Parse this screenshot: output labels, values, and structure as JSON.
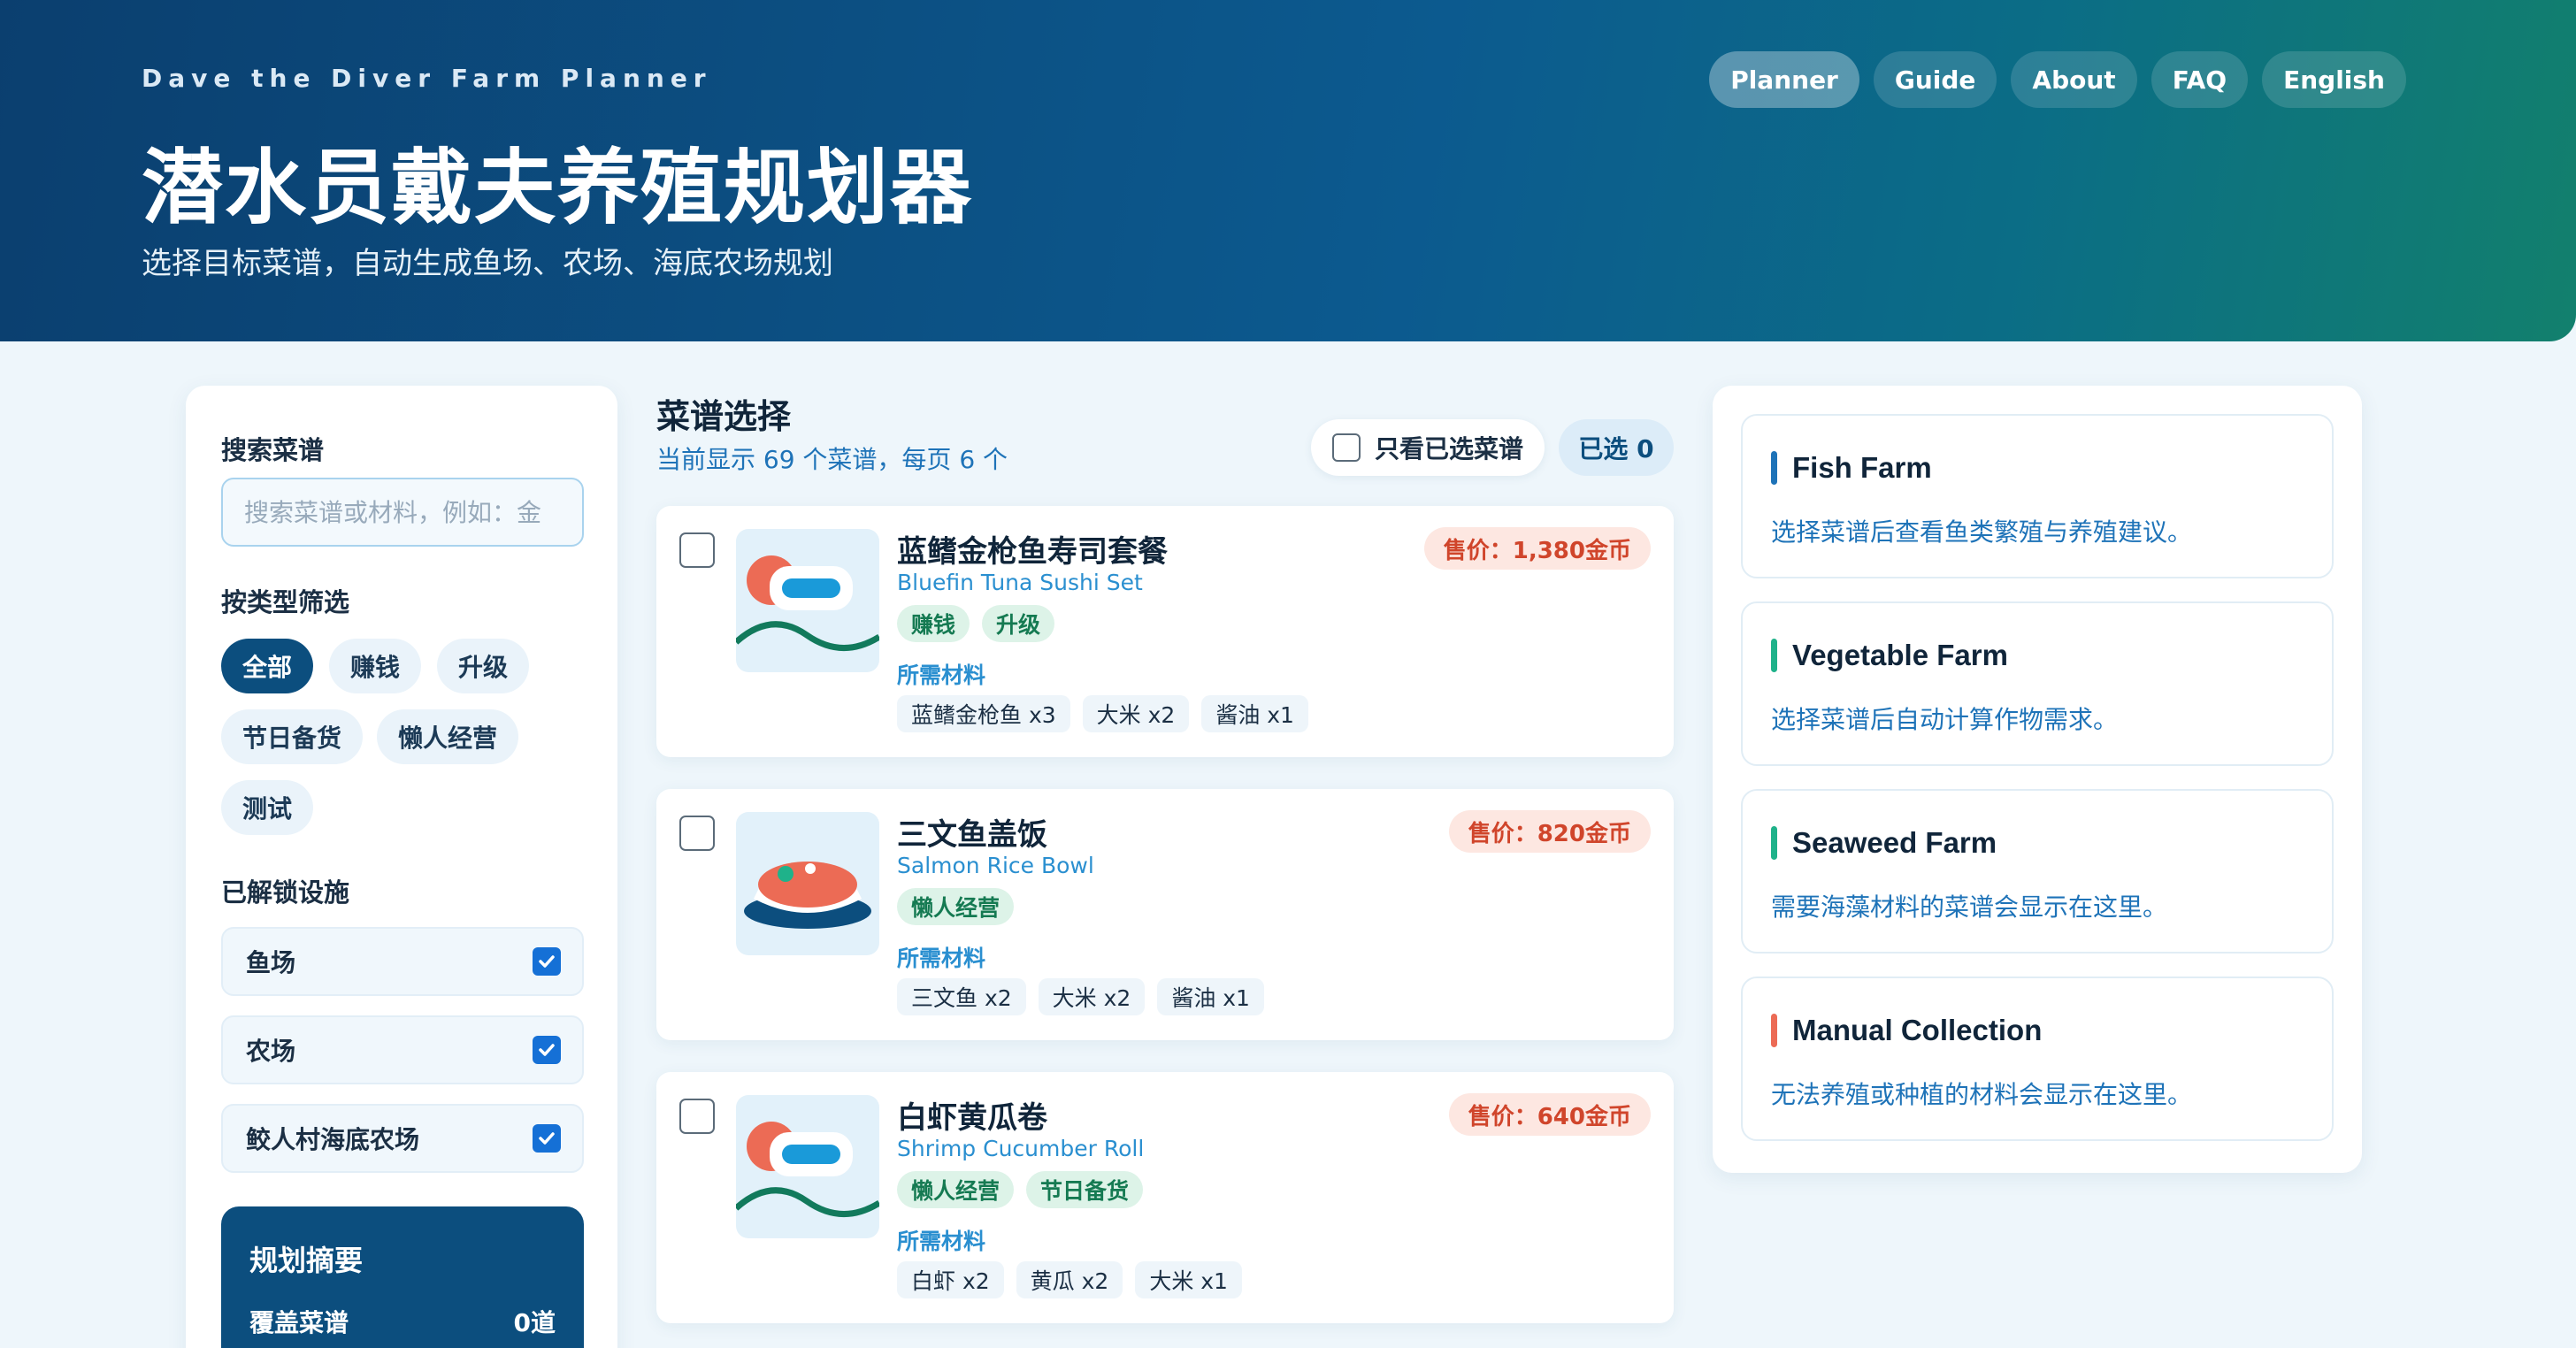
{
  "header": {
    "eyebrow": "Dave the Diver Farm Planner",
    "title": "潜水员戴夫养殖规划器",
    "subtitle": "选择目标菜谱，自动生成鱼场、农场、海底农场规划",
    "nav": [
      "Planner",
      "Guide",
      "About",
      "FAQ",
      "English"
    ],
    "active_nav": "Planner"
  },
  "sidebar": {
    "search_label": "搜索菜谱",
    "search_placeholder": "搜索菜谱或材料，例如：金",
    "filter_label": "按类型筛选",
    "filters": [
      "全部",
      "赚钱",
      "升级",
      "节日备货",
      "懒人经营",
      "测试"
    ],
    "active_filter": "全部",
    "facilities_label": "已解锁设施",
    "facilities": [
      {
        "label": "鱼场",
        "checked": true
      },
      {
        "label": "农场",
        "checked": true
      },
      {
        "label": "鲛人村海底农场",
        "checked": true
      }
    ],
    "summary": {
      "title": "规划摘要",
      "row_label": "覆盖菜谱",
      "row_value": "0道"
    }
  },
  "main": {
    "title": "菜谱选择",
    "subtitle": "当前显示 69 个菜谱，每页 6 个",
    "only_selected_label": "只看已选菜谱",
    "selected_count_label": "已选 0",
    "materials_label": "所需材料",
    "recipes": [
      {
        "name": "蓝鳍金枪鱼寿司套餐",
        "name_en": "Bluefin Tuna Sushi Set",
        "price": "售价：1,380金币",
        "tags": [
          "赚钱",
          "升级"
        ],
        "materials": [
          "蓝鳍金枪鱼 x3",
          "大米 x2",
          "酱油 x1"
        ],
        "icon": "sushi-icon"
      },
      {
        "name": "三文鱼盖饭",
        "name_en": "Salmon Rice Bowl",
        "price": "售价：820金币",
        "tags": [
          "懒人经营"
        ],
        "materials": [
          "三文鱼 x2",
          "大米 x2",
          "酱油 x1"
        ],
        "icon": "rice-bowl-icon"
      },
      {
        "name": "白虾黄瓜卷",
        "name_en": "Shrimp Cucumber Roll",
        "price": "售价：640金币",
        "tags": [
          "懒人经营",
          "节日备货"
        ],
        "materials": [
          "白虾 x2",
          "黄瓜 x2",
          "大米 x1"
        ],
        "icon": "sushi-icon"
      }
    ]
  },
  "farms": [
    {
      "title": "Fish Farm",
      "desc": "选择菜谱后查看鱼类繁殖与养殖建议。",
      "color": "#1e73b8"
    },
    {
      "title": "Vegetable Farm",
      "desc": "选择菜谱后自动计算作物需求。",
      "color": "#1fb28a"
    },
    {
      "title": "Seaweed Farm",
      "desc": "需要海藻材料的菜谱会显示在这里。",
      "color": "#1fb28a"
    },
    {
      "title": "Manual Collection",
      "desc": "无法养殖或种植的材料会显示在这里。",
      "color": "#ec6b55"
    }
  ],
  "colors": {
    "primary": "#0c4e7e",
    "accent_blue": "#1e73b8",
    "price_red": "#d0452b",
    "tag_green": "#157a52"
  }
}
